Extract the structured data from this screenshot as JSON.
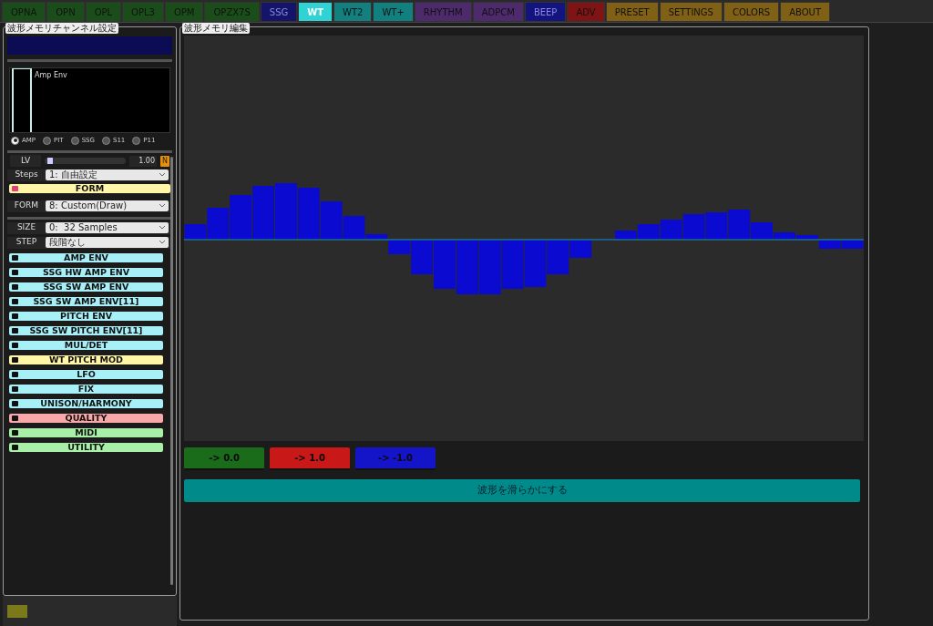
{
  "tabs": [
    {
      "label": "OPNA",
      "color": "#1a4d1a",
      "selected": false
    },
    {
      "label": "OPN",
      "color": "#1a4d1a",
      "selected": false
    },
    {
      "label": "OPL",
      "color": "#1a4d1a",
      "selected": false
    },
    {
      "label": "OPL3",
      "color": "#1a4d1a",
      "selected": false
    },
    {
      "label": "OPM",
      "color": "#1a4d1a",
      "selected": false
    },
    {
      "label": "OPZX7S",
      "color": "#1a4d1a",
      "selected": false
    },
    {
      "label": "SSG",
      "color": "#14146b",
      "selected": false
    },
    {
      "label": "WT",
      "color": "#2fd3d3",
      "selected": true
    },
    {
      "label": "WT2",
      "color": "#138080",
      "selected": false
    },
    {
      "label": "WT+",
      "color": "#138080",
      "selected": false
    },
    {
      "label": "RHYTHM",
      "color": "#4d2a6b",
      "selected": false
    },
    {
      "label": "ADPCM",
      "color": "#4d2a6b",
      "selected": false
    },
    {
      "label": "BEEP",
      "color": "#141480",
      "selected": false
    },
    {
      "label": "ADV",
      "color": "#801414",
      "selected": false
    },
    {
      "label": "PRESET",
      "color": "#806014",
      "selected": false
    },
    {
      "label": "SETTINGS",
      "color": "#806014",
      "selected": false
    },
    {
      "label": "COLORS",
      "color": "#806014",
      "selected": false
    },
    {
      "label": "ABOUT",
      "color": "#806014",
      "selected": false
    }
  ],
  "channel_panel": {
    "title": "波形メモリチャンネル設定",
    "env_graph": {
      "label": "Amp Env"
    },
    "env_options": [
      {
        "label": "AMP",
        "selected": true
      },
      {
        "label": "PIT",
        "selected": false
      },
      {
        "label": "SSG",
        "selected": false
      },
      {
        "label": "S11",
        "selected": false
      },
      {
        "label": "P11",
        "selected": false
      }
    ],
    "lv": {
      "label": "LV",
      "level": 0.03,
      "value": "1.00",
      "badge": "N"
    },
    "steps": {
      "label": "Steps",
      "value": "1: 自由設定"
    },
    "form_header": {
      "label": "FORM",
      "color": "#fff6a8",
      "on": true
    },
    "form": {
      "label": "FORM",
      "value": "8: Custom(Draw)"
    },
    "size": {
      "label": "SIZE",
      "value": "0:  32 Samples"
    },
    "step": {
      "label": "STEP",
      "value": "段階なし"
    },
    "sections": [
      {
        "label": "AMP ENV",
        "color": "#a8f0f8",
        "on": false
      },
      {
        "label": "SSG HW AMP ENV",
        "color": "#a8f0f8",
        "on": false
      },
      {
        "label": "SSG SW AMP ENV",
        "color": "#a8f0f8",
        "on": false
      },
      {
        "label": "SSG SW AMP ENV[11]",
        "color": "#a8f0f8",
        "on": false
      },
      {
        "label": "PITCH ENV",
        "color": "#a8f0f8",
        "on": false
      },
      {
        "label": "SSG SW PITCH ENV[11]",
        "color": "#a8f0f8",
        "on": false
      },
      {
        "label": "MUL/DET",
        "color": "#a8f0f8",
        "on": false
      },
      {
        "label": "WT PITCH MOD",
        "color": "#fff6a8",
        "on": false
      },
      {
        "label": "LFO",
        "color": "#a8f0f8",
        "on": false
      },
      {
        "label": "FIX",
        "color": "#a8f0f8",
        "on": false
      },
      {
        "label": "UNISON/HARMONY",
        "color": "#a8f0f8",
        "on": false
      },
      {
        "label": "QUALITY",
        "color": "#f8a8a8",
        "on": false
      },
      {
        "label": "MIDI",
        "color": "#a8f0a8",
        "on": false
      },
      {
        "label": "UTILITY",
        "color": "#a8f0a8",
        "on": false
      }
    ]
  },
  "wave_panel": {
    "title": "波形メモリ編集",
    "buttons": [
      {
        "label": "-> 0.0",
        "color": "#1a6b1a"
      },
      {
        "label": "-> 1.0",
        "color": "#c81818"
      },
      {
        "label": "-> -1.0",
        "color": "#1414c8"
      }
    ],
    "smooth_button": "波形を滑らかにする"
  }
}
